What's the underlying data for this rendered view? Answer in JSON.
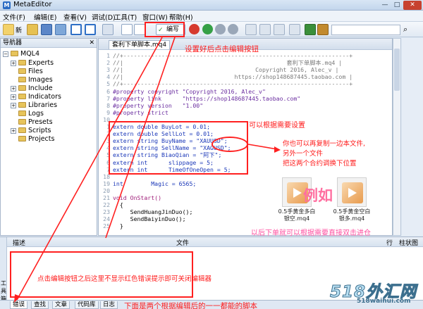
{
  "window": {
    "title": "MetaEditor",
    "min": "—",
    "max": "□",
    "close": "✕"
  },
  "menu": [
    "文件(F)",
    "编辑(E)",
    "查看(V)",
    "调试(D)",
    "工具(T)",
    "窗口(W)",
    "帮助(H)"
  ],
  "toolbar": {
    "new_label": "新",
    "compile_label": "编写",
    "search_placeholder": ""
  },
  "navigator": {
    "title": "导航器",
    "root": "MQL4",
    "items": [
      "Experts",
      "Files",
      "Images",
      "Include",
      "Indicators",
      "Libraries",
      "Logs",
      "Presets",
      "Scripts",
      "Projects"
    ]
  },
  "editor": {
    "tab_title": "套利下单脚本.mq4",
    "lines": [
      {
        "n": "1",
        "t": "//+-----------------------------------------------------------------+",
        "c": "com"
      },
      {
        "n": "2",
        "t": "//|                                               套利下单脚本.mq4 |",
        "c": "com"
      },
      {
        "n": "3",
        "t": "//|                                      Copyright 2016, Alec_v |",
        "c": "com"
      },
      {
        "n": "4",
        "t": "//|                                https://shop148687445.taobao.com |",
        "c": "com"
      },
      {
        "n": "5",
        "t": "//+-----------------------------------------------------------------+",
        "c": "com"
      },
      {
        "n": "6",
        "t": "#property copyright \"Copyright 2016, Alec_v\"",
        "c": "prep"
      },
      {
        "n": "7",
        "t": "#property link      \"https://shop148687445.taobao.com\"",
        "c": "prep"
      },
      {
        "n": "8",
        "t": "#property version   \"1.00\"",
        "c": "prep"
      },
      {
        "n": "9",
        "t": "#property strict",
        "c": "prep"
      },
      {
        "n": "10",
        "t": "",
        "c": ""
      },
      {
        "n": "1",
        "t": "extern double BuyLot = 0.01;",
        "c": "kw"
      },
      {
        "n": "2",
        "t": "extern double SellLot = 0.01;",
        "c": "kw"
      },
      {
        "n": "3",
        "t": "extern string BuyName = \"XAUUSD\";",
        "c": "kw"
      },
      {
        "n": "4",
        "t": "extern string SellName = \"XAGUSD\";",
        "c": "kw"
      },
      {
        "n": "5",
        "t": "extern string BiaoQian = \"阿下\";",
        "c": "kw"
      },
      {
        "n": "6",
        "t": "extern int      slippage = 5;",
        "c": "kw"
      },
      {
        "n": "7",
        "t": "extern int      TimeOfOneOpen = 5;",
        "c": "kw"
      },
      {
        "n": "18",
        "t": "",
        "c": ""
      },
      {
        "n": "19",
        "t": "int        Magic = 6565;",
        "c": "kw"
      },
      {
        "n": "20",
        "t": "",
        "c": ""
      },
      {
        "n": "21",
        "t": "void OnStart()",
        "c": "fn"
      },
      {
        "n": "22",
        "t": "  {",
        "c": ""
      },
      {
        "n": "23",
        "t": "     SendHuangJinDuo();",
        "c": ""
      },
      {
        "n": "24",
        "t": "     SendBaiyinDuo();",
        "c": ""
      },
      {
        "n": "25",
        "t": "  }",
        "c": ""
      }
    ]
  },
  "toolbox": {
    "col_desc": "描述",
    "col_file": "文件",
    "col_row": "行",
    "col_col": "柱状图"
  },
  "bottom_tabs": [
    "错误",
    "查找",
    "文章",
    "代码库",
    "日志"
  ],
  "side_strip": "工具箱",
  "annotations": {
    "setup_hint": "设置好后点击编辑按钮",
    "params_hint": "可以根据需要设置",
    "copy_hint_1": "你也可以再复制一边本文件,",
    "copy_hint_2": "另外一个文件",
    "copy_hint_3": "把这两个合约调换下位置",
    "example": "例如",
    "after_hint": "以后下单就可以根据需要直接双击进仓",
    "compile_hint": "点击编辑按钮之后这里不显示红色错误提示即可关闭编辑器",
    "bottom_hint": "下面是两个根据编辑后的一一都能的脚本"
  },
  "files": [
    {
      "name": "0.5手黄金多白银空.mq4"
    },
    {
      "name": "0.5手黄金空白银多.mq4"
    }
  ],
  "watermark": {
    "brand": "518外汇网",
    "url": "518waihui.com"
  },
  "colors": {
    "annotation": "#ff1a1a",
    "accent": "#2b6cc4"
  }
}
